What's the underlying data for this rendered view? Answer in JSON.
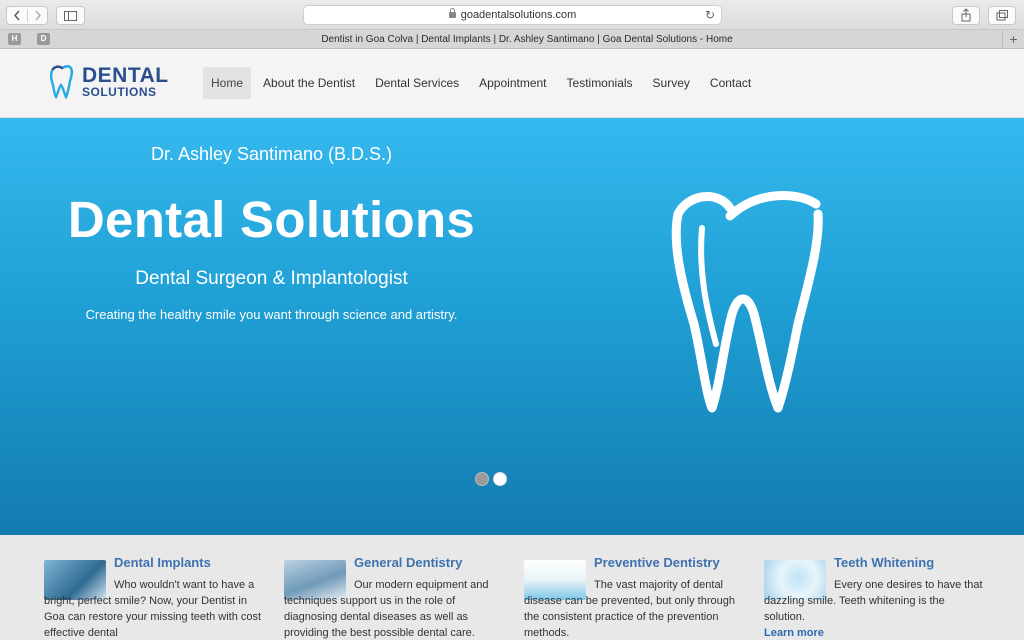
{
  "browser": {
    "url": "goadentalsolutions.com",
    "tab_title": "Dentist in Goa Colva | Dental Implants | Dr. Ashley Santimano | Goa Dental Solutions - Home",
    "favicons": [
      "H",
      "D"
    ],
    "new_tab": "+"
  },
  "site": {
    "logo": {
      "line1": "DENTAL",
      "line2": "SOLUTIONS"
    },
    "menu": [
      {
        "label": "Home"
      },
      {
        "label": "About the Dentist"
      },
      {
        "label": "Dental Services"
      },
      {
        "label": "Appointment"
      },
      {
        "label": "Testimonials"
      },
      {
        "label": "Survey"
      },
      {
        "label": "Contact"
      }
    ],
    "active_menu": "Home"
  },
  "hero": {
    "doctor": "Dr. Ashley Santimano (B.D.S.)",
    "title": "Dental Solutions",
    "subtitle": "Dental Surgeon & Implantologist",
    "tagline": "Creating the healthy smile you want through science and artistry.",
    "slider": {
      "slides": 2,
      "active": 1
    }
  },
  "services": [
    {
      "title": "Dental Implants",
      "text": "Who wouldn't want to have a bright, perfect smile? Now, your Dentist in Goa can restore your missing teeth with cost effective dental",
      "link": "",
      "icon": "implant-photo"
    },
    {
      "title": "General Dentistry",
      "text": "Our modern equipment and techniques support us in the role of diagnosing dental diseases as well as providing the best possible dental care.",
      "link": "",
      "icon": "dental-chair-photo"
    },
    {
      "title": "Preventive Dentistry",
      "text": "The vast majority of dental disease can be prevented, but only through the consistent practice of the prevention methods.",
      "link": "",
      "icon": "toothbrush-photo"
    },
    {
      "title": "Teeth Whitening",
      "text": "Every one desires to have that dazzling smile. Teeth whitening is the solution.",
      "link": "Learn more",
      "icon": "whitening-photo"
    }
  ],
  "colors": {
    "hero_top": "#35b9ee",
    "hero_bottom": "#137bb0",
    "brand": "#2b4f8e",
    "service_title": "#3f72b0"
  }
}
